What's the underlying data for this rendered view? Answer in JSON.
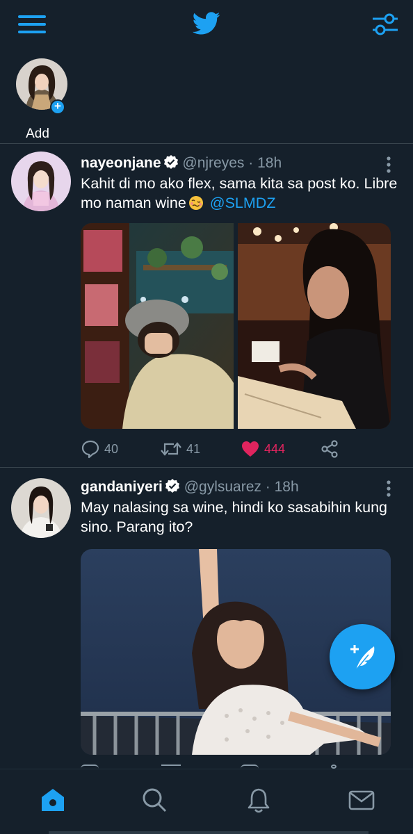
{
  "app": {
    "accent": "#1da1f2",
    "background": "#15202b",
    "like_color": "#e0245e"
  },
  "topbar": {
    "menu_icon": "hamburger-menu-icon",
    "logo_icon": "twitter-bird-icon",
    "settings_icon": "sliders-icon"
  },
  "stories": {
    "items": [
      {
        "label": "Add",
        "icon": "plus-icon"
      }
    ]
  },
  "tweets": [
    {
      "display_name": "nayeonjane",
      "handle": "@njreyes",
      "separator": "·",
      "time": "18h",
      "text_parts": [
        "Kahit di mo ako flex, sama kita  sa post ko. Libre mo naman wine"
      ],
      "mention": "@SLMDZ",
      "emoji": "woozy-face-emoji",
      "counts": {
        "replies": "40",
        "retweets": "41",
        "likes": "444"
      },
      "liked": true
    },
    {
      "display_name": "gandaniyeri",
      "handle": "@gylsuarez",
      "separator": "·",
      "time": "18h",
      "text": "May nalasing sa wine, hindi ko sasabihin kung sino. Parang ito?"
    }
  ],
  "bottom_nav": {
    "items": [
      "home-icon",
      "search-icon",
      "notifications-bell-icon",
      "messages-mail-icon"
    ],
    "active": "home-icon"
  }
}
